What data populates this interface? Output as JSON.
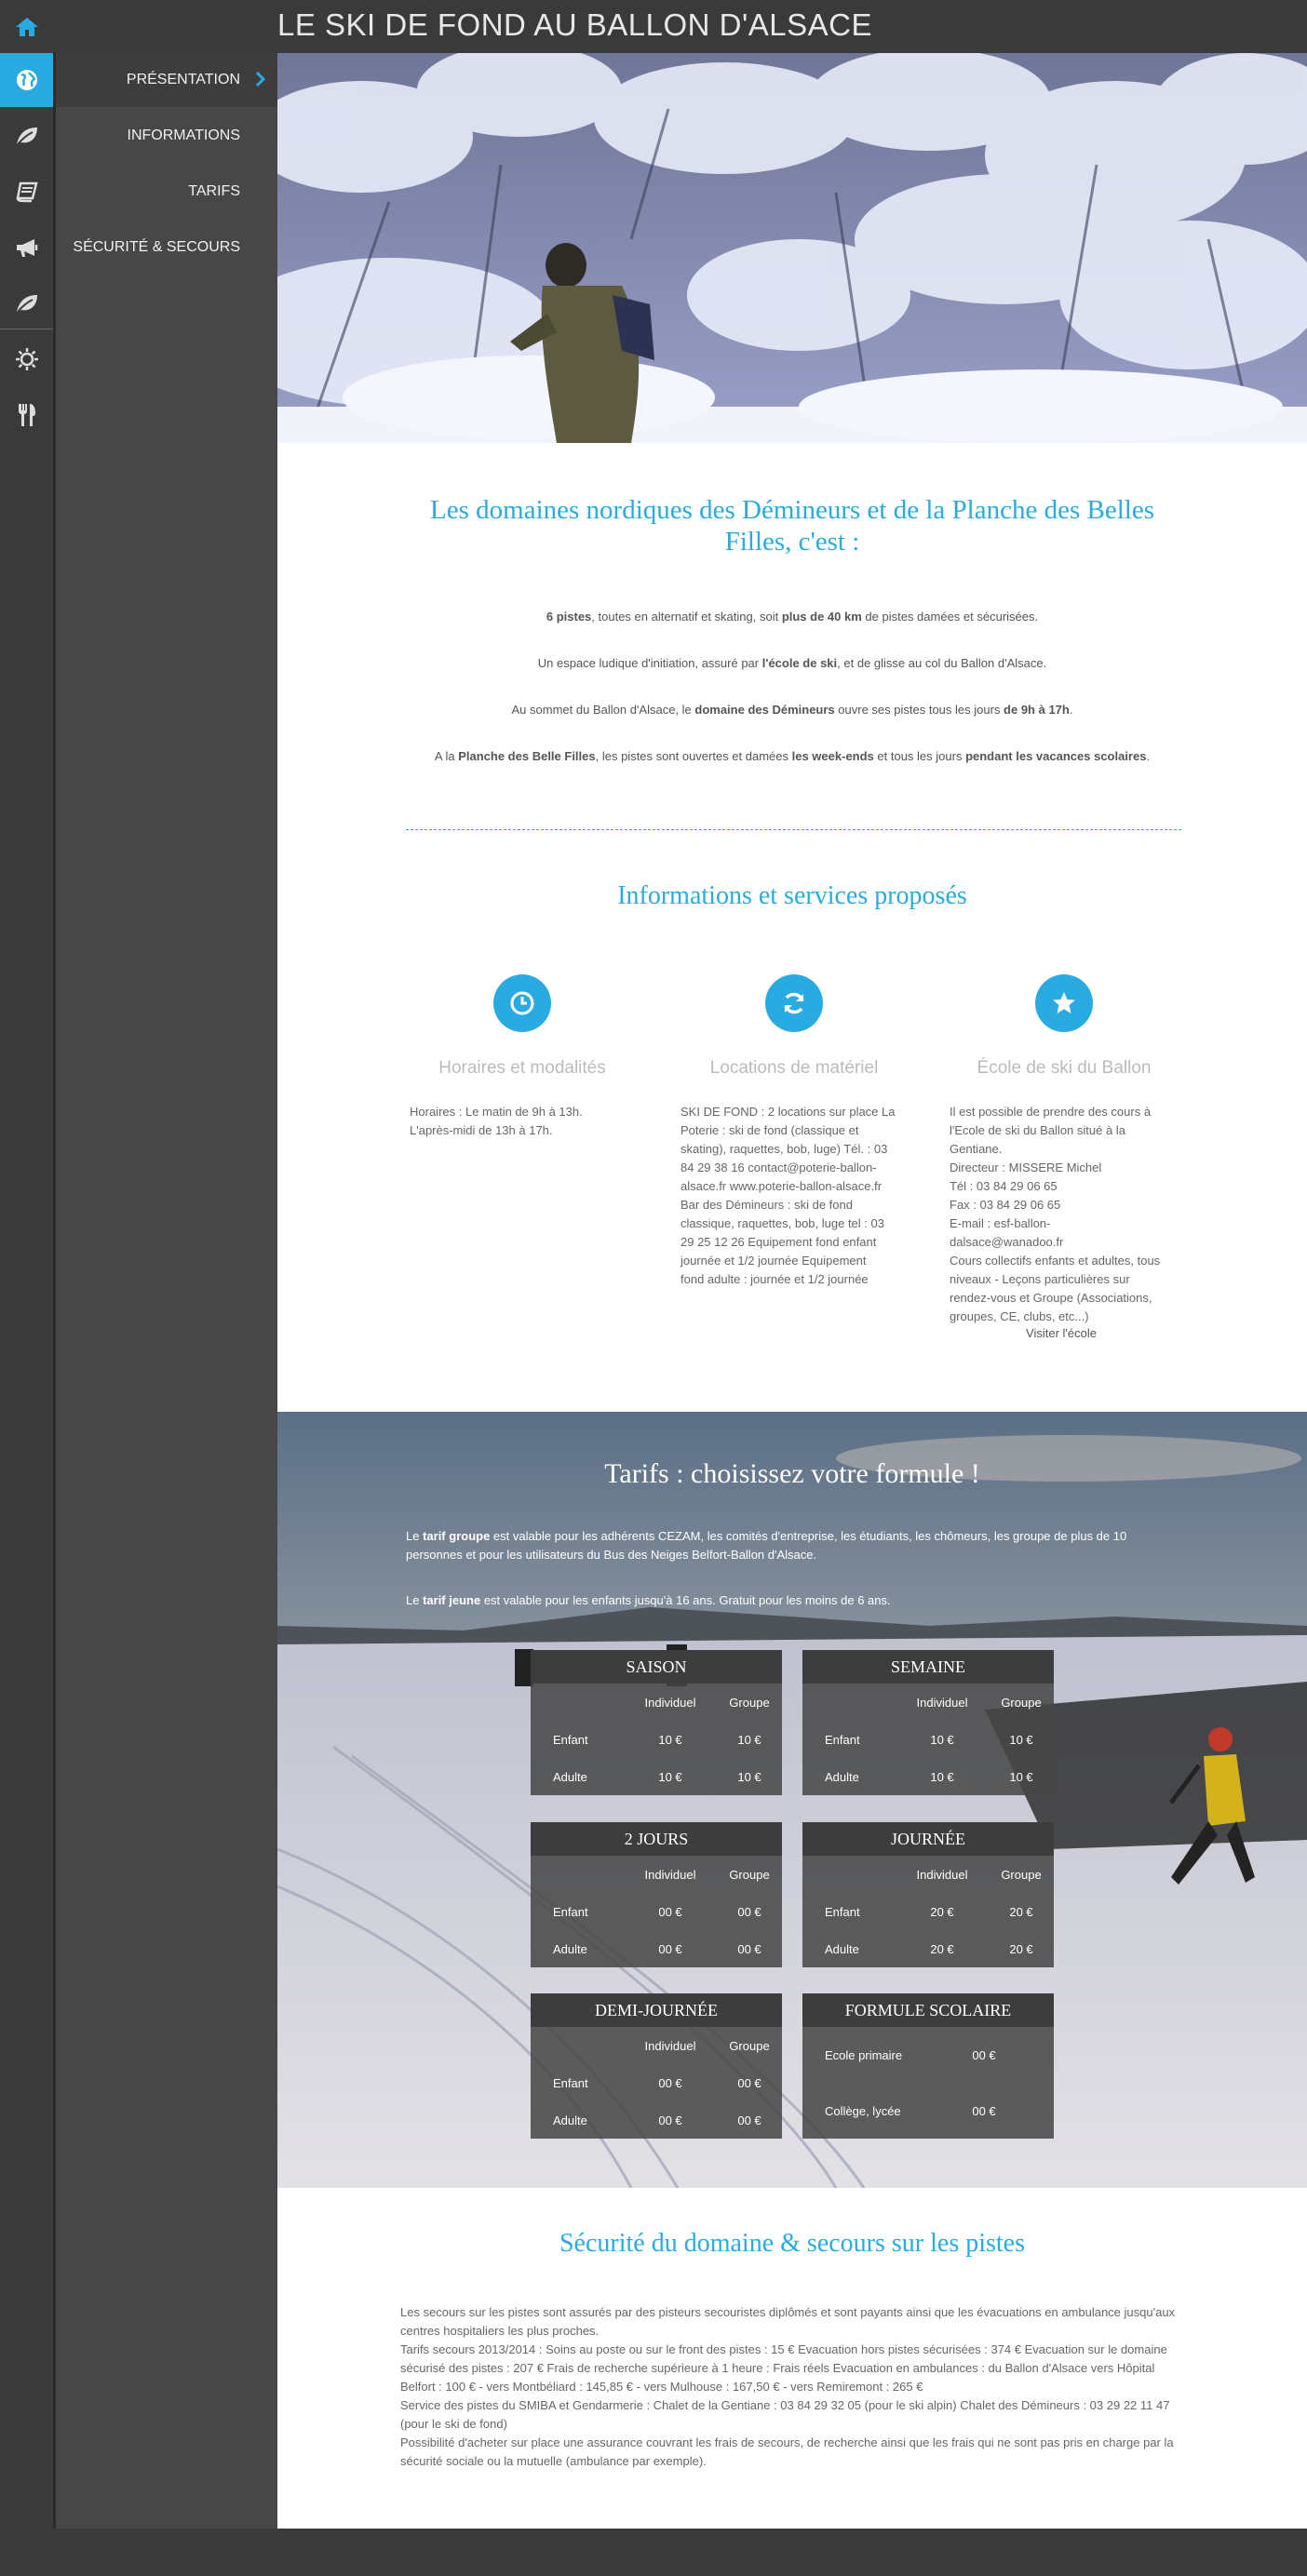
{
  "header": {
    "title": "LE SKI DE FOND AU BALLON D'ALSACE"
  },
  "icons": {
    "home": "home-icon",
    "sidebar": [
      "globe-icon",
      "leaf-icon",
      "book-icon",
      "bullhorn-icon",
      "leaf-icon",
      "sun-icon",
      "cutlery-icon"
    ]
  },
  "colors": {
    "accent": "#29abe2",
    "sidebar": "#474747",
    "dark": "#3a3a3a"
  },
  "nav": {
    "items": [
      {
        "label": "PRÉSENTATION"
      },
      {
        "label": "INFORMATIONS"
      },
      {
        "label": "TARIFS"
      },
      {
        "label": "SÉCURITÉ & SECOURS"
      }
    ]
  },
  "intro": {
    "title": "Les domaines nordiques des Démineurs et de la Planche des Belles Filles, c'est :",
    "p1": [
      {
        "b": "6 pistes"
      },
      {
        "t": ", toutes en alternatif et skating, soit "
      },
      {
        "b": "plus de 40 km"
      },
      {
        "t": " de pistes damées et sécurisées."
      }
    ],
    "p2": [
      {
        "t": "Un espace ludique d'initiation, assuré par "
      },
      {
        "b": "l'école de ski"
      },
      {
        "t": ", et de glisse au col du Ballon d'Alsace."
      }
    ],
    "p3": [
      {
        "t": "Au sommet du Ballon d'Alsace, le "
      },
      {
        "b": "domaine des Démineurs"
      },
      {
        "t": " ouvre ses pistes tous les jours "
      },
      {
        "b": "de 9h à 17h"
      },
      {
        "t": "."
      }
    ],
    "p4": [
      {
        "t": "A la "
      },
      {
        "b": "Planche des Belle Filles"
      },
      {
        "t": ", les pistes sont ouvertes et damées "
      },
      {
        "b": "les week-ends"
      },
      {
        "t": " et tous les jours "
      },
      {
        "b": "pendant les vacances scolaires"
      },
      {
        "t": "."
      }
    ]
  },
  "services": {
    "title": "Informations et services proposés",
    "items": [
      {
        "icon": "clock-icon",
        "title": "Horaires et modalités",
        "text": "Horaires : Le matin de 9h à 13h.\nL'après-midi de 13h à 17h."
      },
      {
        "icon": "refresh-icon",
        "title": "Locations de matériel",
        "text": "SKI DE FOND : 2 locations sur place La\nPoterie : ski de fond (classique et\nskating), raquettes, bob, luge) Tél. : 03\n84 29 38 16 contact@poterie-ballon-\nalsace.fr www.poterie-ballon-alsace.fr\nBar des Démineurs : ski de fond\nclassique, raquettes, bob, luge tel : 03\n29 25 12 26 Equipement fond enfant\njournée et 1/2 journée Equipement\nfond adulte : journée et 1/2 journée"
      },
      {
        "icon": "star-icon",
        "title": "École de ski du Ballon",
        "text": "Il est possible de prendre des cours à\nl'Ecole de ski du Ballon situé à la\nGentiane.\nDirecteur : MISSERE Michel\nTél : 03 84 29 06 65\nFax : 03 84 29 06 65\nE-mail : esf-ballon-\ndalsace@wanadoo.fr\nCours collectifs enfants et adultes, tous\nniveaux - Leçons particulières sur\nrendez-vous et Groupe (Associations,\ngroupes, CE, clubs, etc...)",
        "link": "Visiter l'école"
      }
    ]
  },
  "tarifs": {
    "title": "Tarifs : choisissez votre formule !",
    "note1": [
      {
        "t": "Le "
      },
      {
        "b": "tarif groupe"
      },
      {
        "t": " est valable pour les adhérents CEZAM, les comités d'entreprise, les étudiants, les chômeurs, les groupe de plus de 10 personnes et pour les utilisateurs du Bus des Neiges Belfort-Ballon d'Alsace."
      }
    ],
    "note2": [
      {
        "t": "Le "
      },
      {
        "b": "tarif jeune"
      },
      {
        "t": " est valable pour les enfants jusqu'à 16 ans. Gratuit pour les moins de 6 ans."
      }
    ],
    "col_individuel": "Individuel",
    "col_groupe": "Groupe",
    "cards": [
      {
        "title": "SAISON",
        "rows": [
          {
            "label": "Enfant",
            "ind": "10 €",
            "grp": "10 €"
          },
          {
            "label": "Adulte",
            "ind": "10 €",
            "grp": "10 €"
          }
        ]
      },
      {
        "title": "SEMAINE",
        "rows": [
          {
            "label": "Enfant",
            "ind": "10 €",
            "grp": "10 €"
          },
          {
            "label": "Adulte",
            "ind": "10 €",
            "grp": "10 €"
          }
        ]
      },
      {
        "title": "2 JOURS",
        "rows": [
          {
            "label": "Enfant",
            "ind": "00 €",
            "grp": "00 €"
          },
          {
            "label": "Adulte",
            "ind": "00 €",
            "grp": "00 €"
          }
        ]
      },
      {
        "title": "JOURNÉE",
        "rows": [
          {
            "label": "Enfant",
            "ind": "20 €",
            "grp": "20 €"
          },
          {
            "label": "Adulte",
            "ind": "20 €",
            "grp": "20 €"
          }
        ]
      },
      {
        "title": "DEMI-JOURNÉE",
        "rows": [
          {
            "label": "Enfant",
            "ind": "00 €",
            "grp": "00 €"
          },
          {
            "label": "Adulte",
            "ind": "00 €",
            "grp": "00 €"
          }
        ]
      }
    ],
    "scolaire": {
      "title": "FORMULE SCOLAIRE",
      "rows": [
        {
          "label": "Ecole primaire",
          "price": "00 €"
        },
        {
          "label": "Collège, lycée",
          "price": "00 €"
        }
      ]
    }
  },
  "securite": {
    "title": "Sécurité du domaine & secours sur les pistes",
    "p1": "Les secours sur les pistes sont assurés par des pisteurs secouristes diplômés et sont payants ainsi que les évacuations en ambulance jusqu'aux centres hospitaliers les plus proches.",
    "p2": "Tarifs secours 2013/2014 : Soins au poste ou sur le front des pistes : 15 € Evacuation hors pistes sécurisées : 374 € Evacuation sur le domaine sécurisé des pistes : 207 € Frais de recherche supérieure à 1 heure : Frais réels Evacuation en ambulances : du Ballon d'Alsace vers Hôpital Belfort : 100 € - vers Montbéliard : 145,85 € - vers Mulhouse : 167,50 € - vers Remiremont : 265 €",
    "p3": "Service des pistes du SMIBA et Gendarmerie : Chalet de la Gentiane : 03 84 29 32 05 (pour le ski alpin) Chalet des Démineurs : 03 29 22 11 47 (pour le ski de fond)",
    "p4": "Possibilité d'acheter sur place une assurance couvrant les frais de secours, de recherche ainsi que les frais qui ne sont pas pris en charge par la sécurité sociale ou la mutuelle (ambulance par exemple)."
  }
}
